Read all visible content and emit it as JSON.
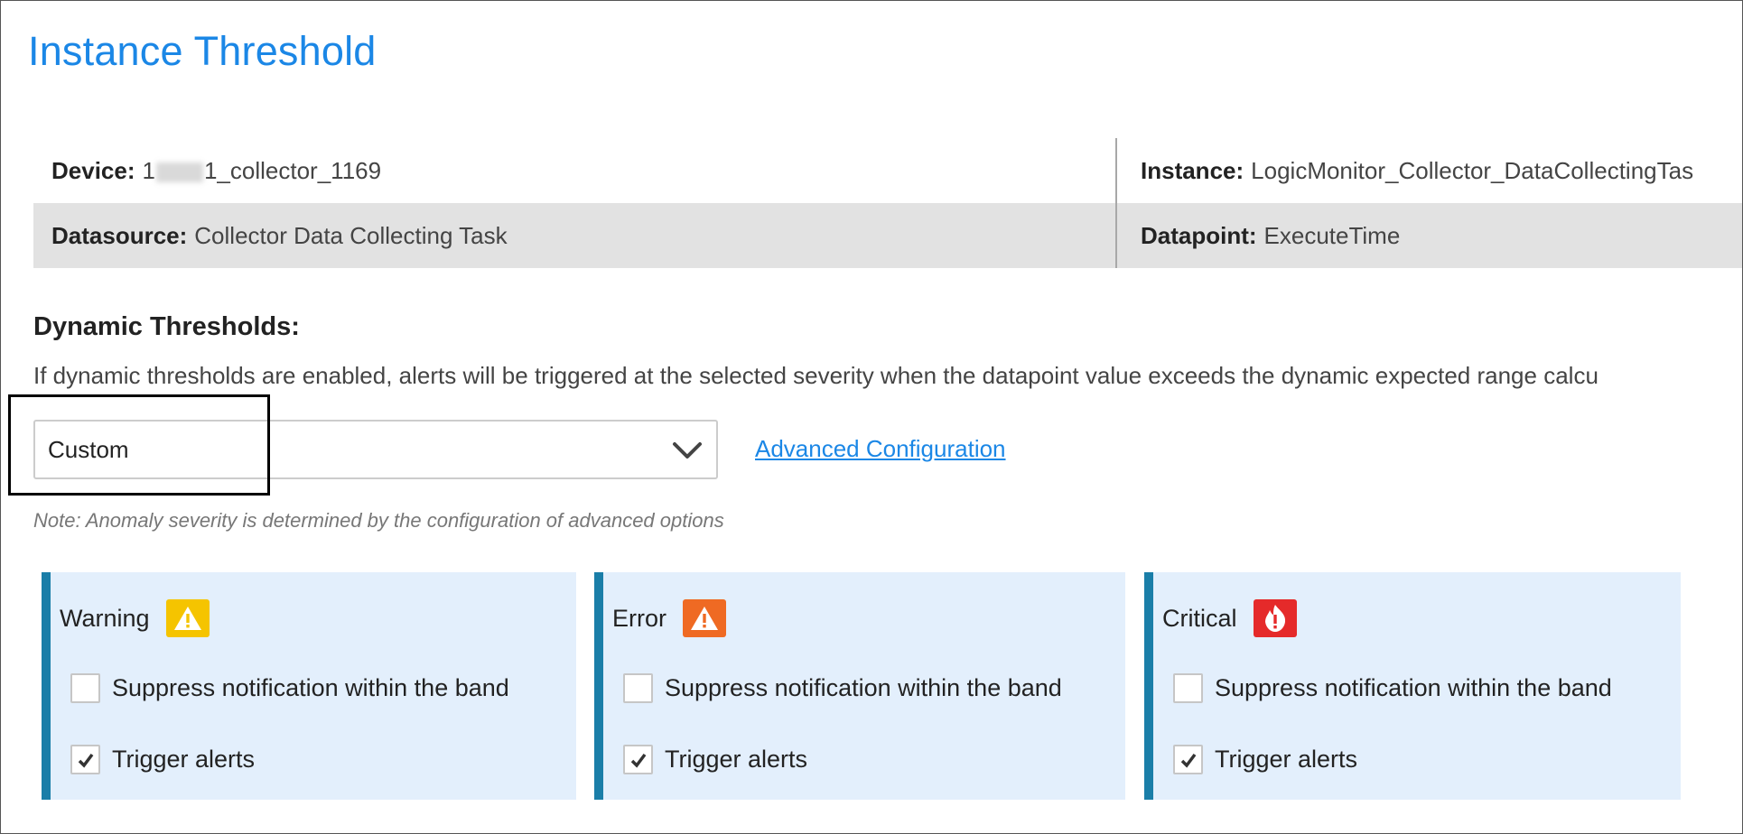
{
  "page": {
    "title": "Instance Threshold"
  },
  "info": {
    "device_label": "Device:",
    "device_value_prefix": "1",
    "device_value_suffix": "1_collector_1169",
    "instance_label": "Instance:",
    "instance_value": "LogicMonitor_Collector_DataCollectingTas",
    "datasource_label": "Datasource:",
    "datasource_value": "Collector Data Collecting Task",
    "datapoint_label": "Datapoint:",
    "datapoint_value": "ExecuteTime"
  },
  "dynamic": {
    "title": "Dynamic Thresholds:",
    "description": "If dynamic thresholds are enabled, alerts will be triggered at the selected severity when the datapoint value exceeds the dynamic expected range calcu",
    "select_value": "Custom",
    "advanced_link": "Advanced Configuration",
    "note": "Note: Anomaly severity is determined by the configuration of advanced options"
  },
  "severities": [
    {
      "name": "Warning",
      "icon": "warning-icon",
      "color": "#f5c400",
      "suppress_label": "Suppress notification within the band",
      "suppress_checked": false,
      "trigger_label": "Trigger alerts",
      "trigger_checked": true
    },
    {
      "name": "Error",
      "icon": "error-icon",
      "color": "#ef6a23",
      "suppress_label": "Suppress notification within the band",
      "suppress_checked": false,
      "trigger_label": "Trigger alerts",
      "trigger_checked": true
    },
    {
      "name": "Critical",
      "icon": "critical-icon",
      "color": "#e52a2a",
      "suppress_label": "Suppress notification within the band",
      "suppress_checked": false,
      "trigger_label": "Trigger alerts",
      "trigger_checked": true
    }
  ],
  "colors": {
    "accent": "#1b87e6",
    "panel_bg": "#e3effc",
    "panel_border": "#1a7ea8",
    "row_alt": "#e2e2e2"
  }
}
